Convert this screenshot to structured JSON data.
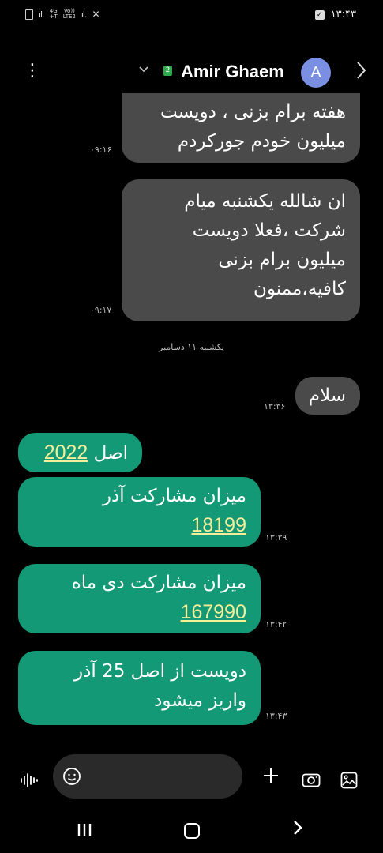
{
  "status_bar": {
    "net_top": "4G",
    "net_sub": "+T",
    "volte_top": "Vo))",
    "volte_sub": "LTE2",
    "time": "۱۳:۴۳"
  },
  "header": {
    "sim_number": "2",
    "contact_name": "Amir Ghaem",
    "avatar_letter": "A"
  },
  "messages": [
    {
      "dir": "in",
      "lines": [
        "هفته برام بزنی ، دویست",
        "میلیون خودم جورکردم"
      ],
      "time": "۰۹:۱۶"
    },
    {
      "dir": "in",
      "lines": [
        "ان شالله یکشنبه میام",
        "شرکت ،فعلا دویست",
        "میلیون برام بزنی",
        "کافیه،ممنون"
      ],
      "time": "۰۹:۱۷"
    },
    {
      "dir": "in",
      "lines": [
        "سلام"
      ],
      "time": "۱۳:۳۶"
    },
    {
      "dir": "out",
      "text": "اصل",
      "number": "2022"
    },
    {
      "dir": "out",
      "lines": [
        "میزان مشارکت آذر"
      ],
      "number": "18199",
      "time": "۱۳:۳۹"
    },
    {
      "dir": "out",
      "lines": [
        "میزان مشارکت دی ماه"
      ],
      "number": "167990",
      "time": "۱۳:۴۲"
    },
    {
      "dir": "out",
      "lines": [
        "دویست از اصل 25 آذر",
        "واریز میشود"
      ],
      "time": "۱۳:۴۳"
    }
  ],
  "date_separator": "یکشنبه ۱۱ دسامبر",
  "composer": {
    "placeholder": ""
  },
  "colors": {
    "incoming_bubble": "#4a4a4a",
    "outgoing_bubble": "#139976",
    "link": "#f7ee9a",
    "avatar": "#7b8fe2",
    "sim_badge": "#2da84b"
  },
  "icons": [
    "menu-icon",
    "chevron-down-icon",
    "chevron-right-icon",
    "voice-icon",
    "emoji-icon",
    "plus-icon",
    "camera-icon",
    "gallery-icon"
  ]
}
